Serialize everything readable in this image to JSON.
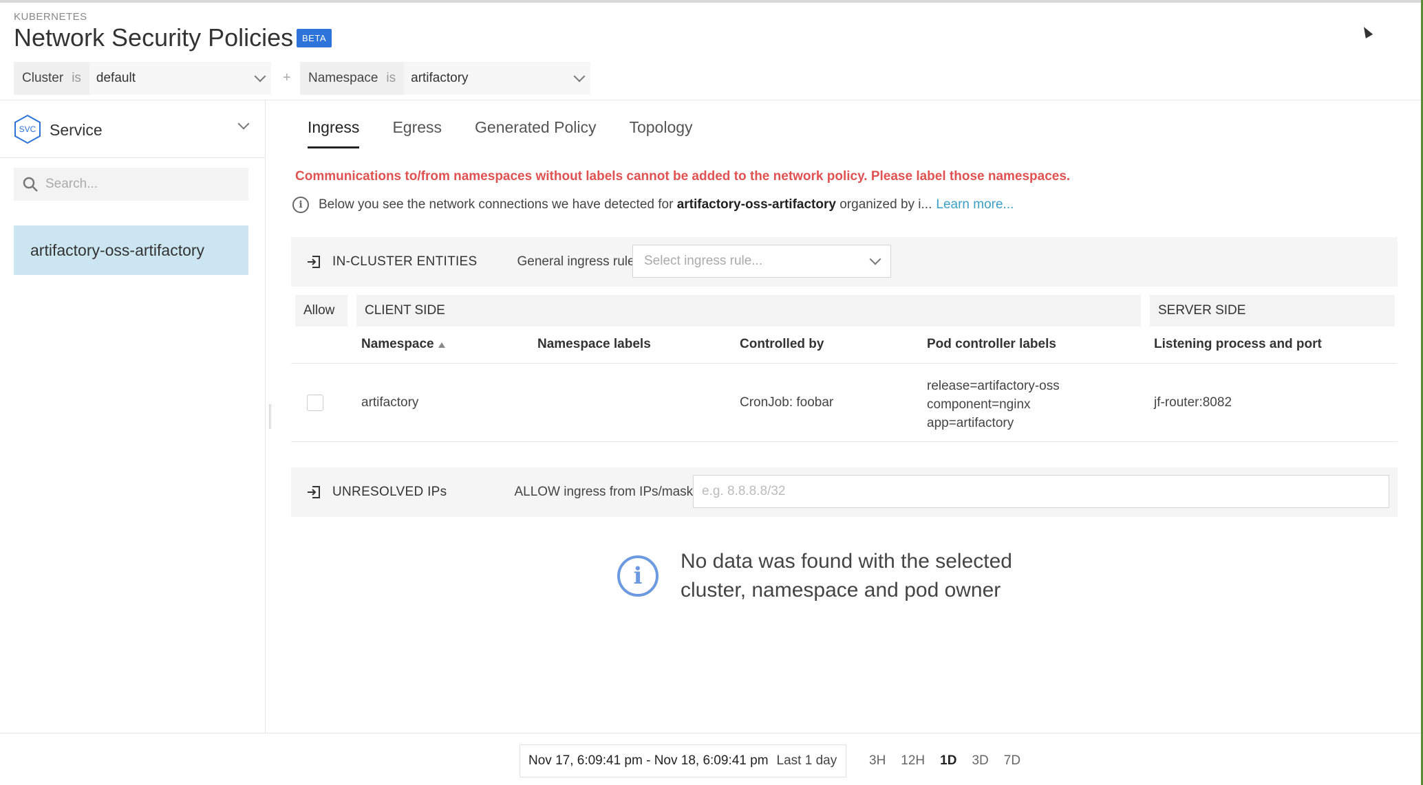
{
  "header": {
    "eyebrow": "KUBERNETES",
    "title": "Network Security Policies",
    "badge": "BETA",
    "filters": [
      {
        "key": "Cluster",
        "op": "is",
        "value": "default"
      },
      {
        "key": "Namespace",
        "op": "is",
        "value": "artifactory"
      }
    ],
    "add_filter": "+"
  },
  "sidebar": {
    "type_icon": "SVC",
    "type_label": "Service",
    "search_placeholder": "Search...",
    "items": [
      {
        "label": "artifactory-oss-artifactory",
        "selected": true
      }
    ]
  },
  "tabs": [
    {
      "label": "Ingress",
      "active": true
    },
    {
      "label": "Egress",
      "active": false
    },
    {
      "label": "Generated Policy",
      "active": false
    },
    {
      "label": "Topology",
      "active": false
    }
  ],
  "warning": "Communications to/from namespaces without labels cannot be added to the network policy. Please label those namespaces.",
  "info": {
    "prefix": "Below you see the network connections we have detected for",
    "entity": "artifactory-oss-artifactory",
    "suffix": "organized by i...",
    "link": "Learn more..."
  },
  "in_cluster": {
    "title": "IN-CLUSTER ENTITIES",
    "rules_label": "General ingress rules",
    "rules_placeholder": "Select ingress rule...",
    "groups": {
      "allow": "Allow",
      "client": "CLIENT SIDE",
      "server": "SERVER SIDE"
    },
    "columns": [
      "Namespace",
      "Namespace labels",
      "Controlled by",
      "Pod controller labels",
      "Listening process and port"
    ],
    "rows": [
      {
        "namespace": "artifactory",
        "namespace_labels": "",
        "controlled_by": "CronJob: foobar",
        "pod_labels": [
          "release=artifactory-oss",
          "component=nginx",
          "app=artifactory"
        ],
        "listening": "jf-router:8082",
        "allowed": false
      }
    ]
  },
  "unresolved": {
    "title": "UNRESOLVED IPs",
    "label": "ALLOW ingress from IPs/mask",
    "placeholder": "e.g. 8.8.8.8/32"
  },
  "empty_state": {
    "line1": "No data was found with the selected",
    "line2": "cluster, namespace and pod owner"
  },
  "footer": {
    "range": "Nov 17, 6:09:41 pm - Nov 18, 6:09:41 pm",
    "range_label": "Last 1 day",
    "presets": [
      "3H",
      "12H",
      "1D",
      "3D",
      "7D"
    ],
    "active_preset": "1D"
  },
  "colors": {
    "accent": "#2d74da",
    "warning": "#e05252",
    "link": "#3aa0c8",
    "selected_item": "#cbe6f1",
    "empty_icon": "#6b9ae0"
  }
}
